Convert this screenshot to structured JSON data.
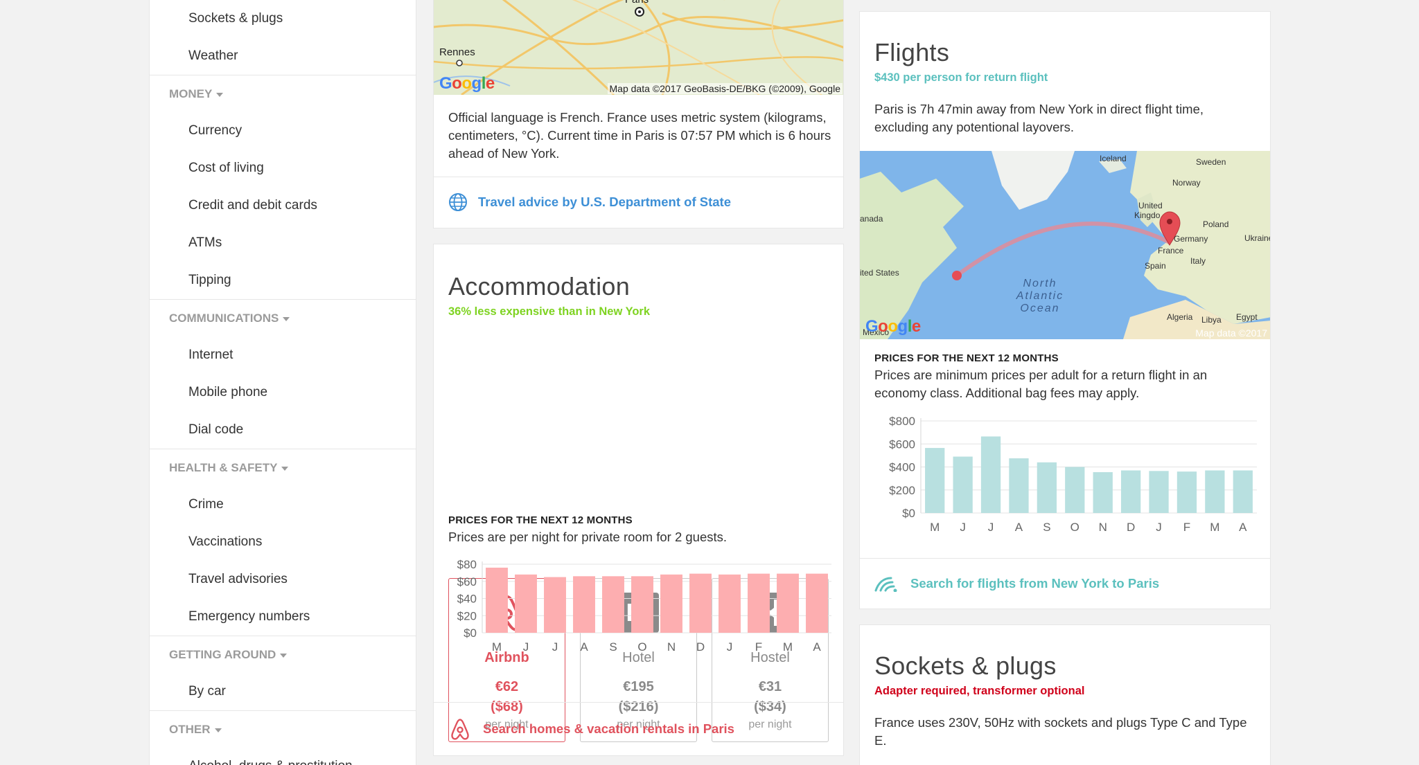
{
  "sidebar": {
    "items_top": [
      "Sockets & plugs",
      "Weather"
    ],
    "groups": [
      {
        "label": "MONEY",
        "items": [
          "Currency",
          "Cost of living",
          "Credit and debit cards",
          "ATMs",
          "Tipping"
        ]
      },
      {
        "label": "COMMUNICATIONS",
        "items": [
          "Internet",
          "Mobile phone",
          "Dial code"
        ]
      },
      {
        "label": "HEALTH & SAFETY",
        "items": [
          "Crime",
          "Vaccinations",
          "Travel advisories",
          "Emergency numbers"
        ]
      },
      {
        "label": "GETTING AROUND",
        "items": [
          "By car"
        ]
      },
      {
        "label": "OTHER",
        "items": [
          "Alcohol, drugs & prostitution"
        ]
      }
    ]
  },
  "info_card": {
    "map_labels": {
      "city": "Paris",
      "other": "Rennes"
    },
    "map_attribution": "Map data ©2017 GeoBasis-DE/BKG (©2009), Google",
    "google_logo": "Google",
    "text": "Official language is French. France uses metric system (kilograms, centimeters, °C). Current time in Paris is 07:57 PM which is 6 hours ahead of New York.",
    "advice_link": "Travel advice by U.S. Department of State"
  },
  "accommodation": {
    "title": "Accommodation",
    "subtitle": "36% less expensive than in New York",
    "options": [
      {
        "name": "Airbnb",
        "price_eur": "€62",
        "price_usd": "($68)",
        "unit": "per night",
        "icon": "airbnb-logo-icon"
      },
      {
        "name": "Hotel",
        "price_eur": "€195",
        "price_usd": "($216)",
        "unit": "per night",
        "icon": "booking-logo-icon"
      },
      {
        "name": "Hostel",
        "price_eur": "€31",
        "price_usd": "($34)",
        "unit": "per night",
        "icon": "hostelworld-logo-icon"
      }
    ],
    "hotel_icon_text": "B.",
    "prices_label": "PRICES FOR THE NEXT 12 MONTHS",
    "prices_note": "Prices are per night for private room for 2 guests.",
    "search_link": "Search homes & vacation rentals in Paris",
    "colors": {
      "accent": "#e0525d",
      "bar": "#fdaeb0",
      "sub": "#7ed321"
    }
  },
  "flights": {
    "title": "Flights",
    "subtitle": "$430 per person for return flight",
    "text": "Paris is 7h 47min away from New York in direct flight time, excluding any potentional layovers.",
    "map_labels": [
      "Iceland",
      "Sweden",
      "Norway",
      "United",
      "Kingdo",
      "Poland",
      "Germany",
      "Ukraine",
      "France",
      "Italy",
      "Spain",
      "anada",
      "ited States",
      "North",
      "Atlantic",
      "Ocean",
      "Algeria",
      "Libya",
      "Egypt",
      "Mexico"
    ],
    "map_attribution": "Map data ©2017",
    "google_logo": "Google",
    "prices_label": "PRICES FOR THE NEXT 12 MONTHS",
    "prices_note": "Prices are minimum prices per adult for a return flight in an economy class. Additional bag fees may apply.",
    "search_link": "Search for flights from New York to Paris",
    "colors": {
      "accent": "#5bc0be",
      "bar": "#b8e0e0"
    }
  },
  "sockets": {
    "title": "Sockets & plugs",
    "subtitle": "Adapter required, transformer optional",
    "text": "France uses 230V, 50Hz with sockets and plugs Type C and Type E.",
    "color": "#d0021b"
  },
  "chart_data": [
    {
      "type": "bar",
      "categories": [
        "M",
        "J",
        "J",
        "A",
        "S",
        "O",
        "N",
        "D",
        "J",
        "F",
        "M",
        "A"
      ],
      "values": [
        76,
        68,
        65,
        66,
        66,
        66,
        68,
        69,
        68,
        69,
        69,
        69
      ],
      "ylim": [
        0,
        80
      ],
      "yticks": [
        "$0",
        "$20",
        "$40",
        "$60",
        "$80"
      ],
      "grid": true
    },
    {
      "type": "bar",
      "categories": [
        "M",
        "J",
        "J",
        "A",
        "S",
        "O",
        "N",
        "D",
        "J",
        "F",
        "M",
        "A"
      ],
      "values": [
        565,
        490,
        665,
        475,
        440,
        400,
        355,
        370,
        365,
        360,
        370,
        370
      ],
      "ylim": [
        0,
        800
      ],
      "yticks": [
        "$0",
        "$200",
        "$400",
        "$600",
        "$800"
      ],
      "grid": true
    }
  ]
}
